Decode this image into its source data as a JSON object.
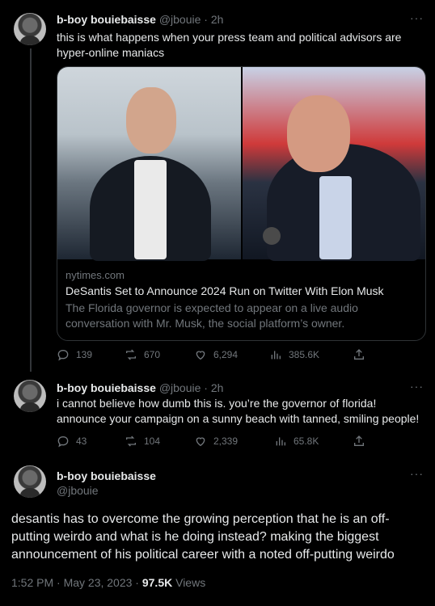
{
  "tweets": [
    {
      "name": "b-boy bouiebaisse",
      "handle": "@jbouie",
      "time": "2h",
      "text": "this is what happens when your press team and political advisors are hyper-online maniacs",
      "card": {
        "domain": "nytimes.com",
        "title": "DeSantis Set to Announce 2024 Run on Twitter With Elon Musk",
        "description": "The Florida governor is expected to appear on a live audio conversation with Mr. Musk, the social platform’s owner."
      },
      "stats": {
        "replies": "139",
        "retweets": "670",
        "likes": "6,294",
        "views": "385.6K"
      }
    },
    {
      "name": "b-boy bouiebaisse",
      "handle": "@jbouie",
      "time": "2h",
      "text": "i cannot believe how dumb this is. you’re the governor of florida! announce your campaign on a sunny beach with tanned, smiling people!",
      "stats": {
        "replies": "43",
        "retweets": "104",
        "likes": "2,339",
        "views": "65.8K"
      }
    }
  ],
  "focused": {
    "name": "b-boy bouiebaisse",
    "handle": "@jbouie",
    "text": "desantis has to overcome the growing perception that he is an off-putting weirdo and what is he doing instead? making the biggest announcement of his political career with a noted off-putting weirdo",
    "timestamp": "1:52 PM · May 23, 2023 · ",
    "views_count": "97.5K",
    "views_label": " Views"
  },
  "ui": {
    "more": "···",
    "dot": " · "
  }
}
